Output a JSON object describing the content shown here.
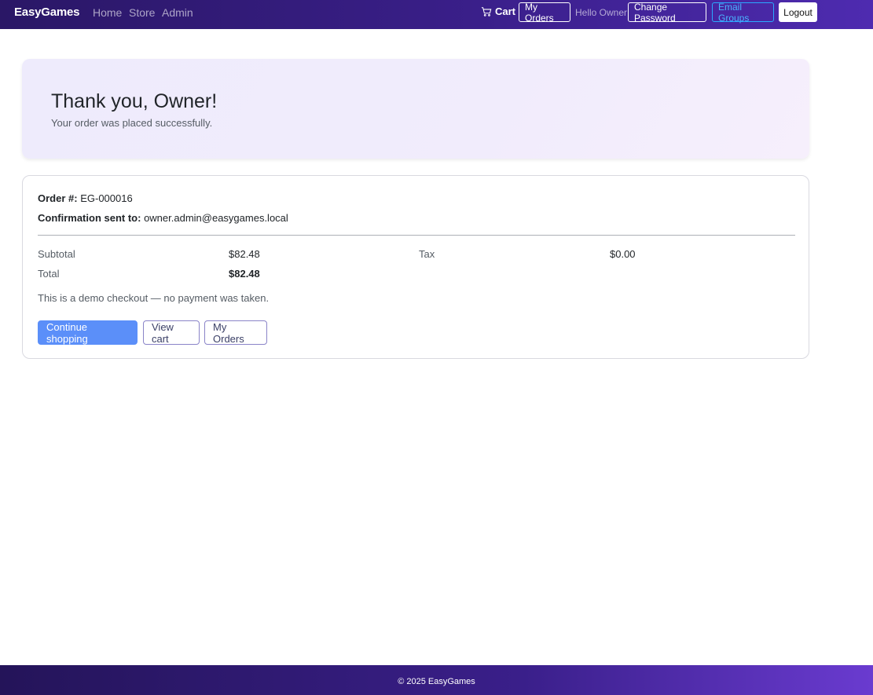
{
  "navbar": {
    "brand": "EasyGames",
    "links": [
      "Home",
      "Store",
      "Admin"
    ],
    "cart_label": "Cart",
    "my_orders_label": "My Orders",
    "hello_text": "Hello Owner",
    "change_password_label": "Change Password",
    "email_groups_label": "Email Groups",
    "logout_label": "Logout"
  },
  "hero": {
    "title": "Thank you, Owner!",
    "subtitle": "Your order was placed successfully."
  },
  "order": {
    "order_label": "Order #:",
    "order_number": "EG-000016",
    "confirmation_label": "Confirmation sent to:",
    "confirmation_email": "owner.admin@easygames.local",
    "subtotal_label": "Subtotal",
    "subtotal_value": "$82.48",
    "tax_label": "Tax",
    "tax_value": "$0.00",
    "total_label": "Total",
    "total_value": "$82.48",
    "note": "This is a demo checkout — no payment was taken.",
    "buttons": {
      "continue": "Continue shopping",
      "view_cart": "View cart",
      "my_orders": "My Orders"
    }
  },
  "footer": {
    "text": "© 2025 EasyGames"
  },
  "colors": {
    "nav_gradient_start": "#2a1766",
    "nav_gradient_end": "#4e2bb0",
    "primary_button": "#5b8ff9",
    "info_outline": "#2ba8ff"
  }
}
